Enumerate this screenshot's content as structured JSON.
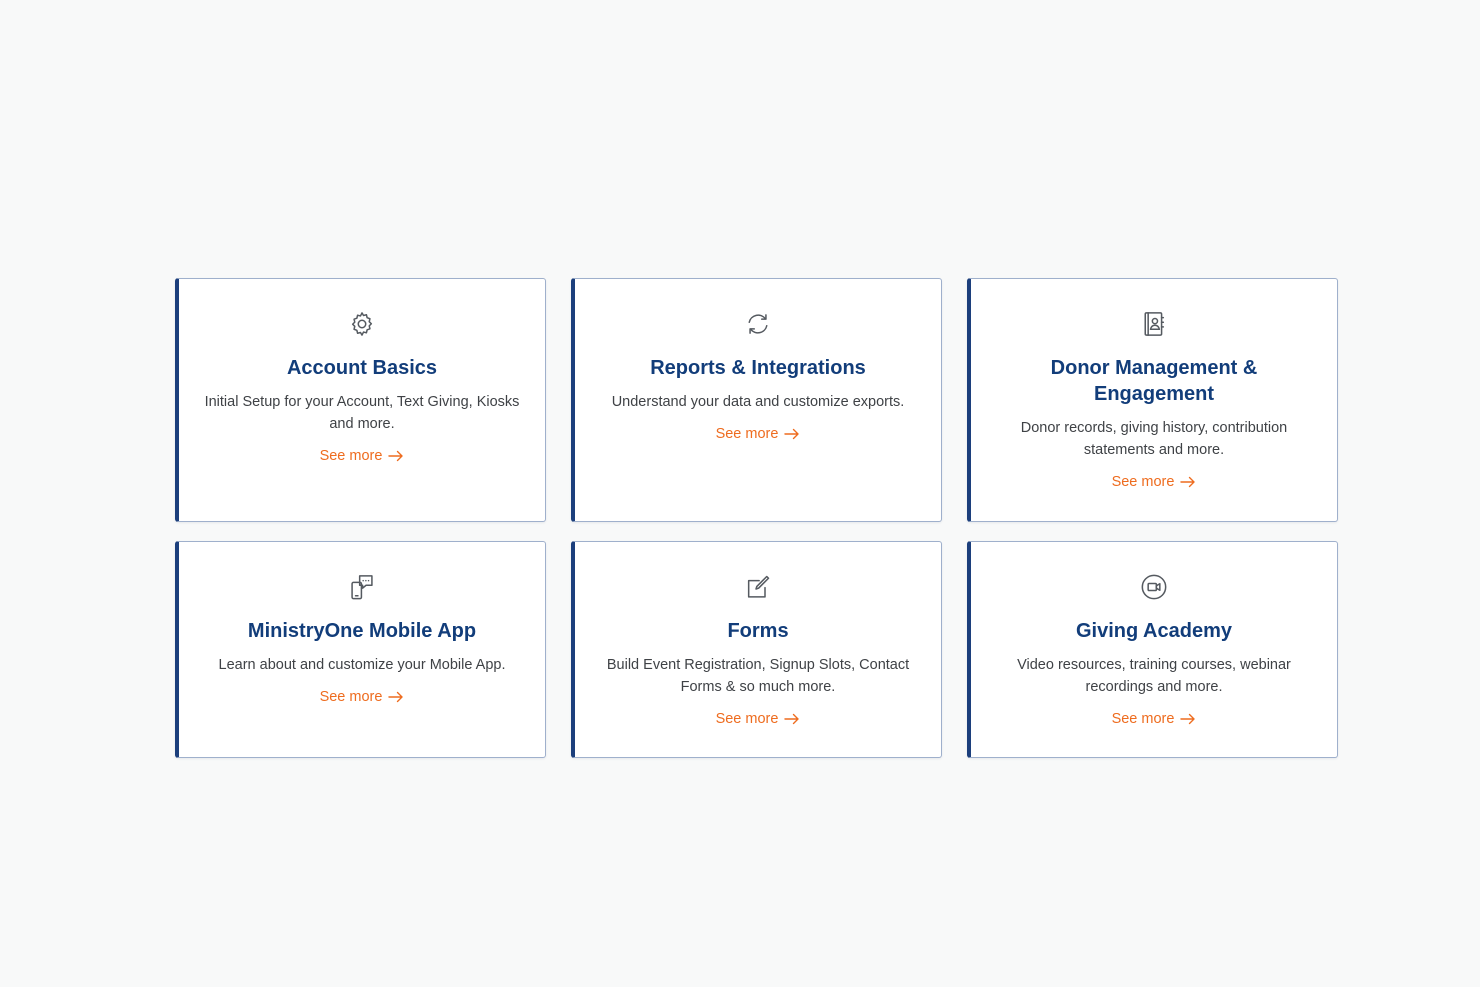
{
  "cards": [
    {
      "icon": "gear-icon",
      "title": "Account Basics",
      "description": "Initial Setup for your Account, Text Giving, Kiosks and more.",
      "link": "See more"
    },
    {
      "icon": "sync-icon",
      "title": "Reports & Integrations",
      "description": "Understand your data and customize exports.",
      "link": "See more"
    },
    {
      "icon": "address-book-icon",
      "title": "Donor Management & Engagement",
      "description": "Donor records, giving history, contribution statements and more.",
      "link": "See more"
    },
    {
      "icon": "mobile-chat-icon",
      "title": "MinistryOne Mobile App",
      "description": "Learn about and customize your Mobile App.",
      "link": "See more"
    },
    {
      "icon": "edit-form-icon",
      "title": "Forms",
      "description": "Build Event Registration, Signup Slots, Contact Forms & so much more.",
      "link": "See more"
    },
    {
      "icon": "video-camera-icon",
      "title": "Giving Academy",
      "description": "Video resources, training courses, webinar recordings and more.",
      "link": "See more"
    }
  ],
  "colors": {
    "title": "#123d7a",
    "accent_border": "#1c3f7c",
    "link": "#ee6c1f",
    "background": "#f8f9f9"
  }
}
